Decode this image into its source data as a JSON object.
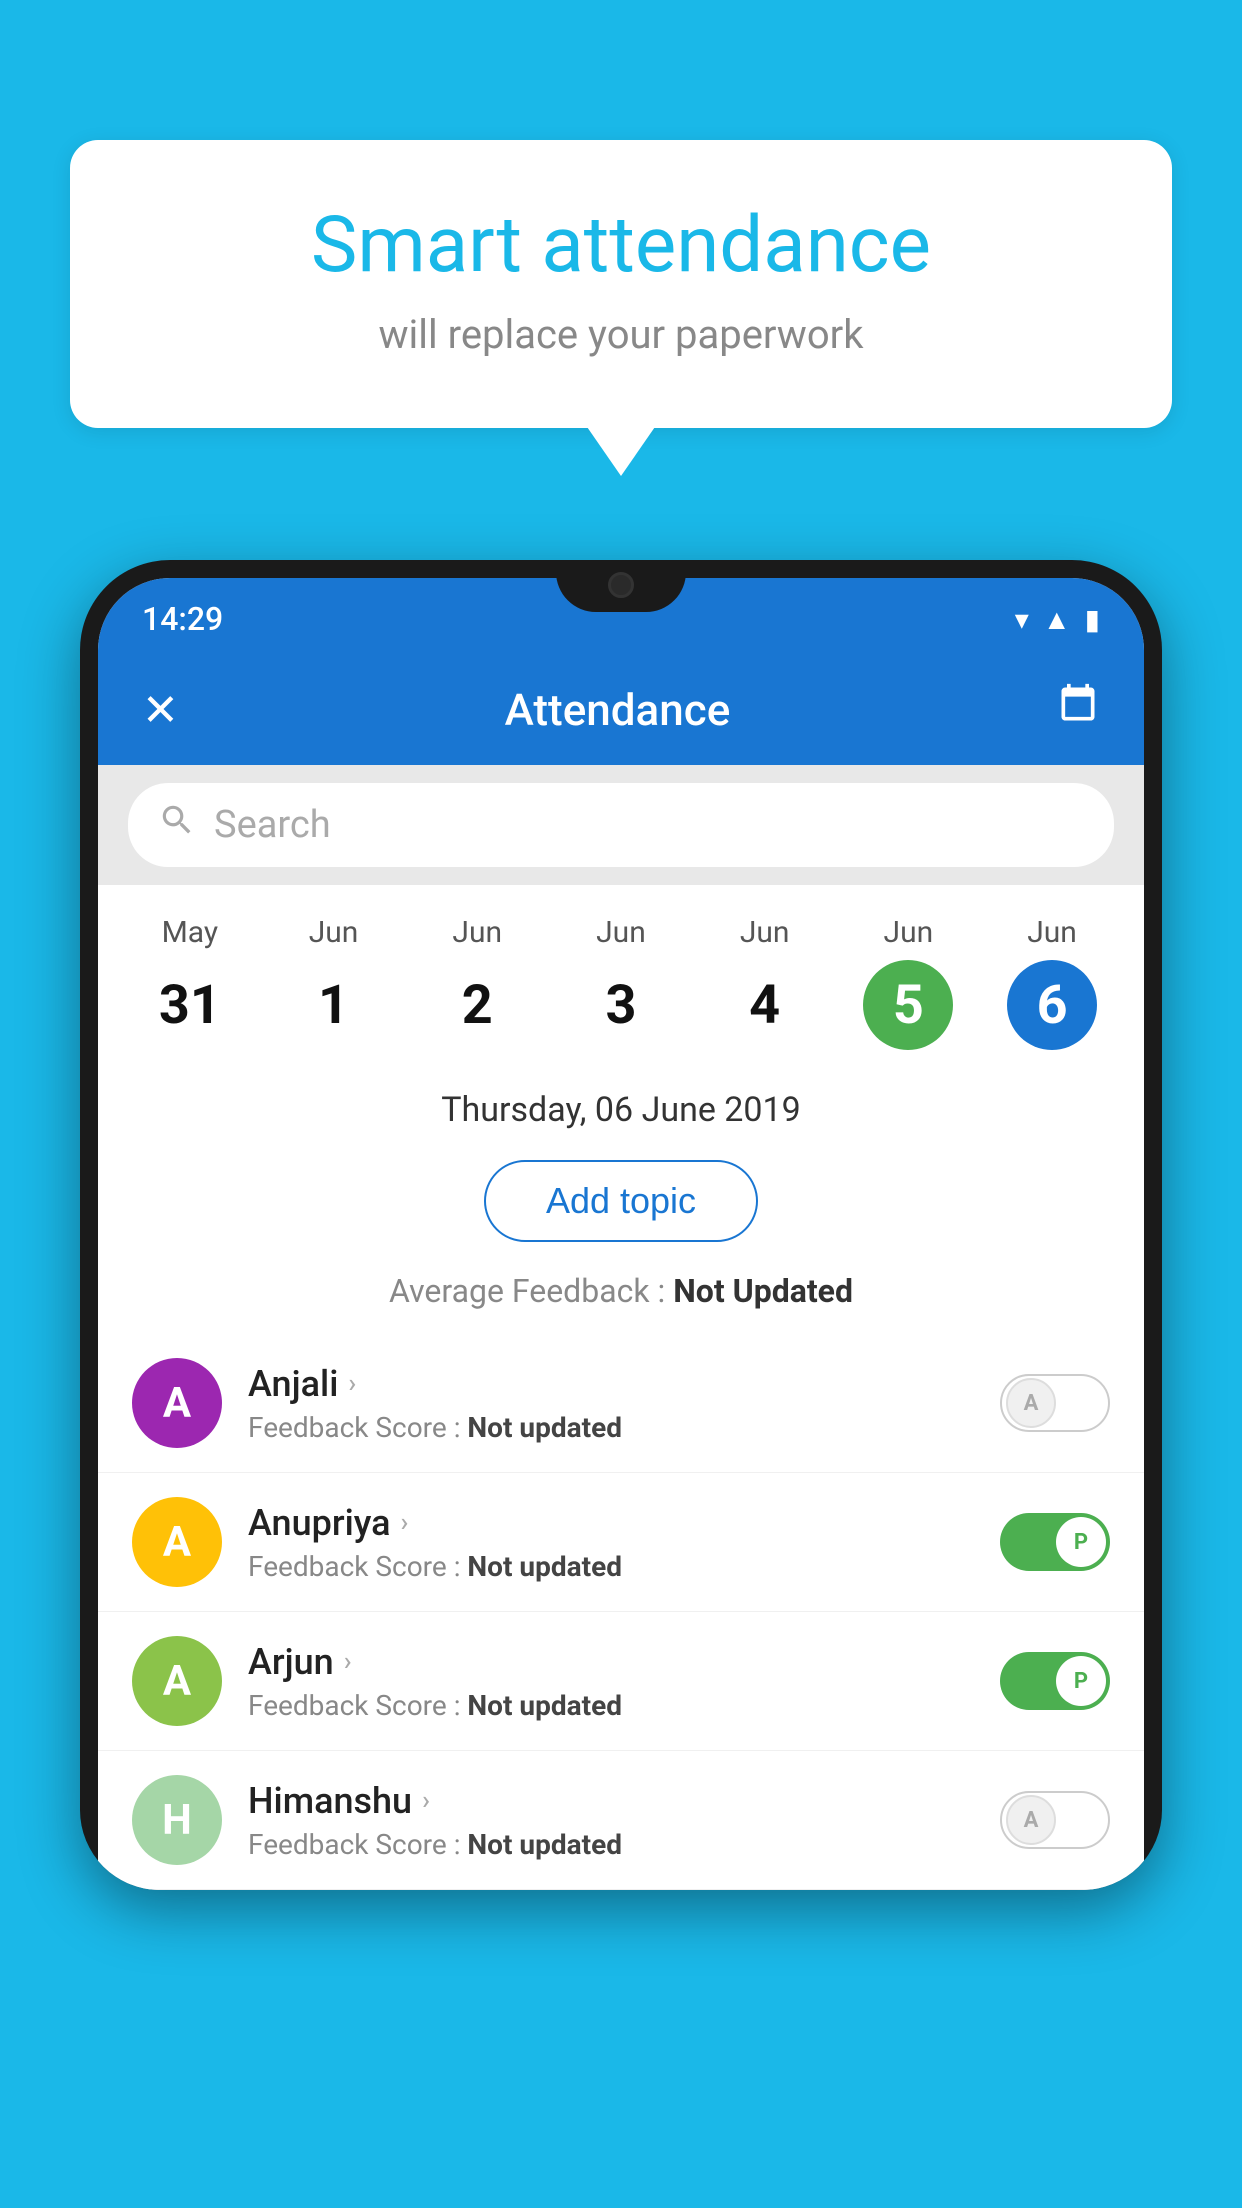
{
  "background_color": "#1ab8e8",
  "speech_bubble": {
    "title": "Smart attendance",
    "subtitle": "will replace your paperwork"
  },
  "phone": {
    "status_bar": {
      "time": "14:29",
      "icons": [
        "wifi",
        "signal",
        "battery"
      ]
    },
    "app_bar": {
      "title": "Attendance",
      "close_icon": "✕",
      "calendar_icon": "📅"
    },
    "search": {
      "placeholder": "Search"
    },
    "calendar": {
      "days": [
        {
          "month": "May",
          "date": "31",
          "highlight": "none"
        },
        {
          "month": "Jun",
          "date": "1",
          "highlight": "none"
        },
        {
          "month": "Jun",
          "date": "2",
          "highlight": "none"
        },
        {
          "month": "Jun",
          "date": "3",
          "highlight": "none"
        },
        {
          "month": "Jun",
          "date": "4",
          "highlight": "none"
        },
        {
          "month": "Jun",
          "date": "5",
          "highlight": "green"
        },
        {
          "month": "Jun",
          "date": "6",
          "highlight": "blue"
        }
      ]
    },
    "selected_date": "Thursday, 06 June 2019",
    "add_topic_label": "Add topic",
    "avg_feedback_label": "Average Feedback : ",
    "avg_feedback_value": "Not Updated",
    "students": [
      {
        "name": "Anjali",
        "avatar_letter": "A",
        "avatar_color": "#9c27b0",
        "feedback_label": "Feedback Score : ",
        "feedback_value": "Not updated",
        "toggle": "off",
        "toggle_label": "A"
      },
      {
        "name": "Anupriya",
        "avatar_letter": "A",
        "avatar_color": "#ffc107",
        "feedback_label": "Feedback Score : ",
        "feedback_value": "Not updated",
        "toggle": "on",
        "toggle_label": "P"
      },
      {
        "name": "Arjun",
        "avatar_letter": "A",
        "avatar_color": "#8bc34a",
        "feedback_label": "Feedback Score : ",
        "feedback_value": "Not updated",
        "toggle": "on",
        "toggle_label": "P"
      },
      {
        "name": "Himanshu",
        "avatar_letter": "H",
        "avatar_color": "#a5d6a7",
        "feedback_label": "Feedback Score : ",
        "feedback_value": "Not updated",
        "toggle": "off",
        "toggle_label": "A"
      }
    ]
  }
}
